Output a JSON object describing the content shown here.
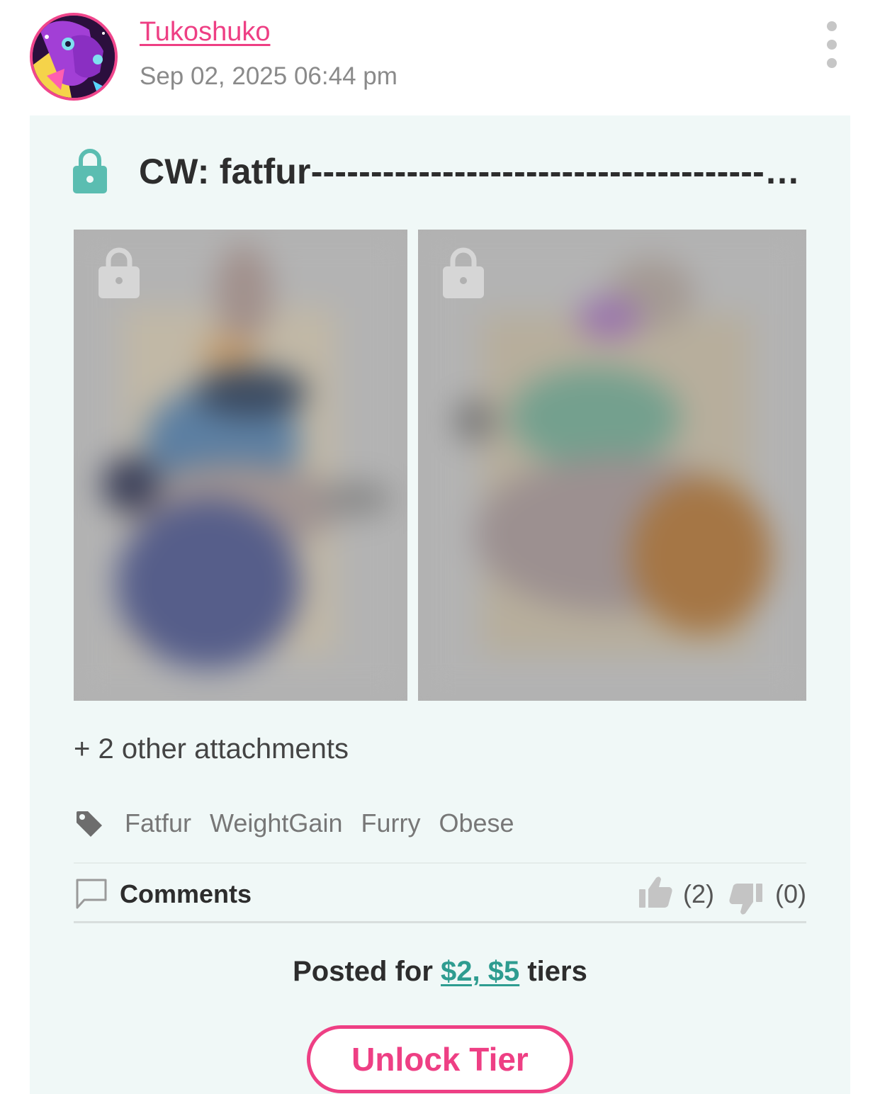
{
  "author": {
    "name": "Tukoshuko",
    "posted_at": "Sep 02, 2025 06:44 pm"
  },
  "post": {
    "title": "CW: fatfur-----------------------------------------------------------",
    "locked": true,
    "other_attachments": "+ 2 other attachments",
    "tags": [
      "Fatfur",
      "WeightGain",
      "Furry",
      "Obese"
    ]
  },
  "footer": {
    "comments_label": "Comments",
    "likes": "(2)",
    "dislikes": "(0)"
  },
  "tier_info": {
    "prefix": "Posted for ",
    "tiers": "$2, $5",
    "suffix": " tiers"
  },
  "unlock_button": "Unlock Tier",
  "colors": {
    "accent_pink": "#ee3f84",
    "accent_teal": "#5bbdb1",
    "card_bg": "#f0f8f7"
  }
}
